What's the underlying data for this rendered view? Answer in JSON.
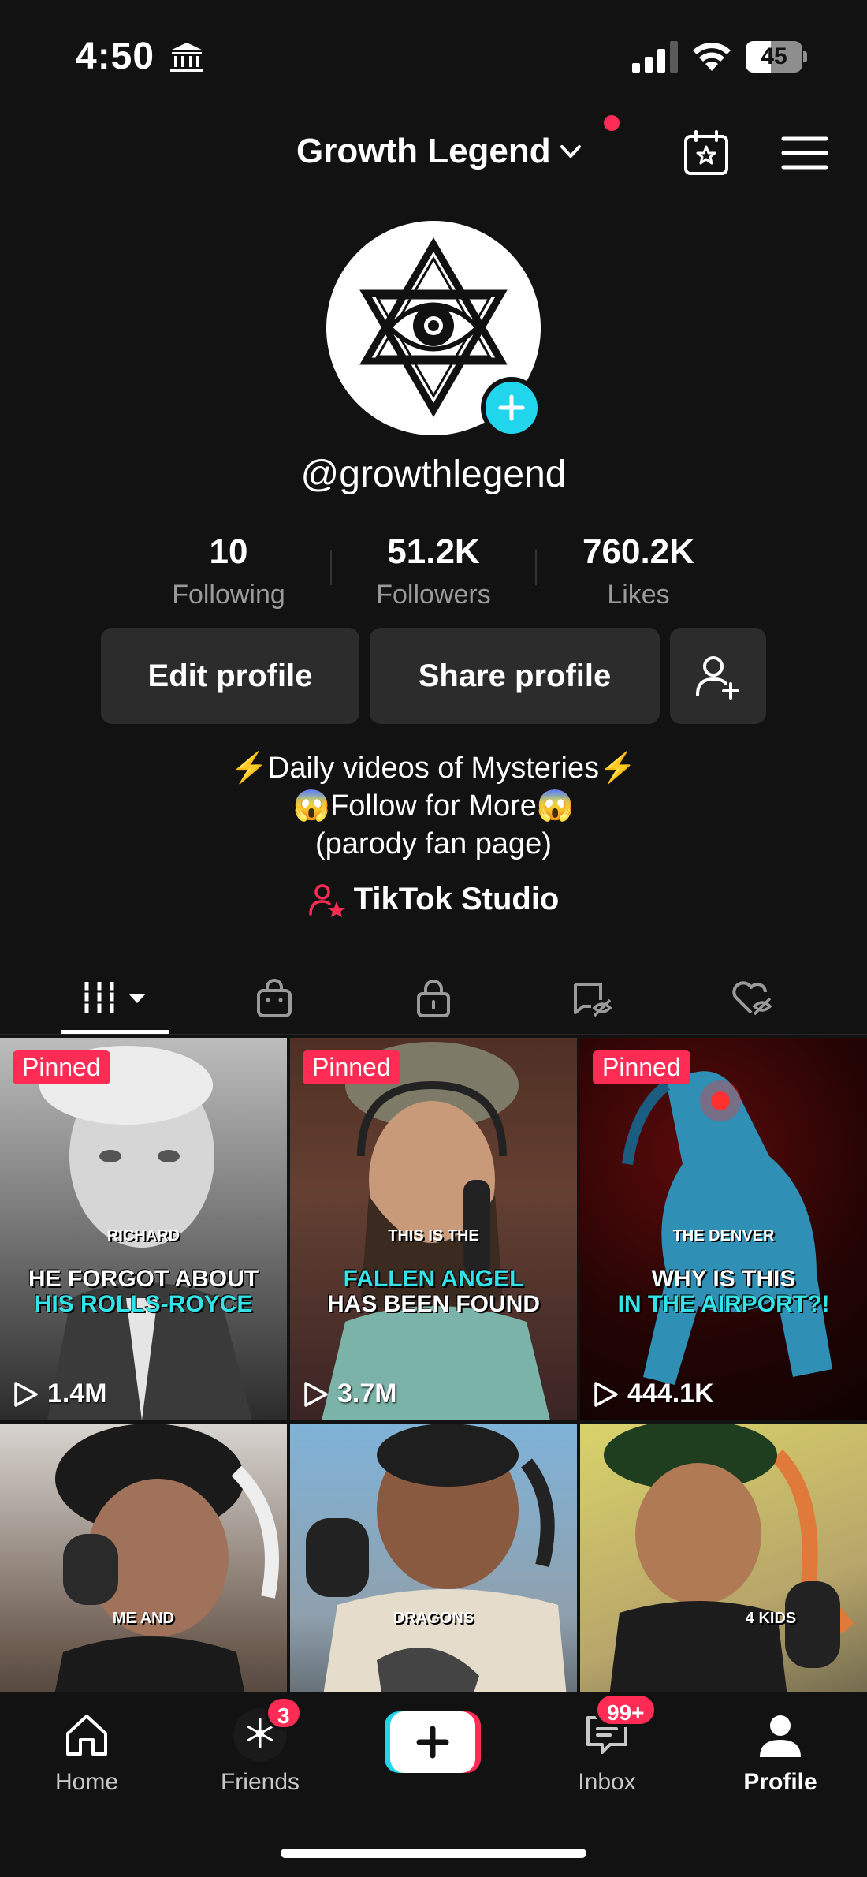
{
  "status_bar": {
    "time": "4:50",
    "battery_text": "45",
    "battery_level": 0.45,
    "icons": [
      "bank-icon",
      "signal-icon",
      "wifi-icon",
      "battery-icon"
    ]
  },
  "header": {
    "account_name": "Growth Legend",
    "icons": [
      "chevron-down-icon",
      "calendar-star-icon",
      "menu-icon"
    ],
    "notification_dot_color": "#fe2c55"
  },
  "profile": {
    "username": "@growthlegend",
    "stats": [
      {
        "value": "10",
        "label": "Following"
      },
      {
        "value": "51.2K",
        "label": "Followers"
      },
      {
        "value": "760.2K",
        "label": "Likes"
      }
    ],
    "buttons": {
      "edit": "Edit profile",
      "share": "Share profile"
    },
    "bio": [
      "⚡Daily videos of Mysteries⚡",
      "😱Follow for More😱",
      "(parody fan page)"
    ],
    "studio_link": "TikTok Studio"
  },
  "tabs": [
    "videos-grid-icon",
    "shop-bag-icon",
    "private-lock-icon",
    "reposts-icon",
    "liked-hidden-icon"
  ],
  "videos": [
    {
      "pinned": "Pinned",
      "caption_small": "RICHARD",
      "caption_line1": "HE FORGOT ABOUT",
      "caption_line2": "HIS ROLLS-ROYCE",
      "views": "1.4M"
    },
    {
      "pinned": "Pinned",
      "caption_small": "THIS IS THE",
      "caption_line1": "FALLEN ANGEL",
      "caption_line2": "HAS BEEN FOUND",
      "views": "3.7M"
    },
    {
      "pinned": "Pinned",
      "caption_small": "THE DENVER",
      "caption_line1": "WHY IS THIS",
      "caption_line2": "IN THE AIRPORT?!",
      "views": "444.1K"
    },
    {
      "caption_small": "ME AND"
    },
    {
      "caption_small": "DRAGONS"
    },
    {
      "caption_small": "4 KIDS"
    }
  ],
  "bottom_nav": {
    "home": "Home",
    "friends": "Friends",
    "friends_badge": "3",
    "inbox": "Inbox",
    "inbox_badge": "99+",
    "profile": "Profile"
  },
  "colors": {
    "accent_red": "#fe2c55",
    "accent_cyan": "#20d5ec",
    "background": "#121212",
    "button_bg": "#2c2c2c"
  }
}
